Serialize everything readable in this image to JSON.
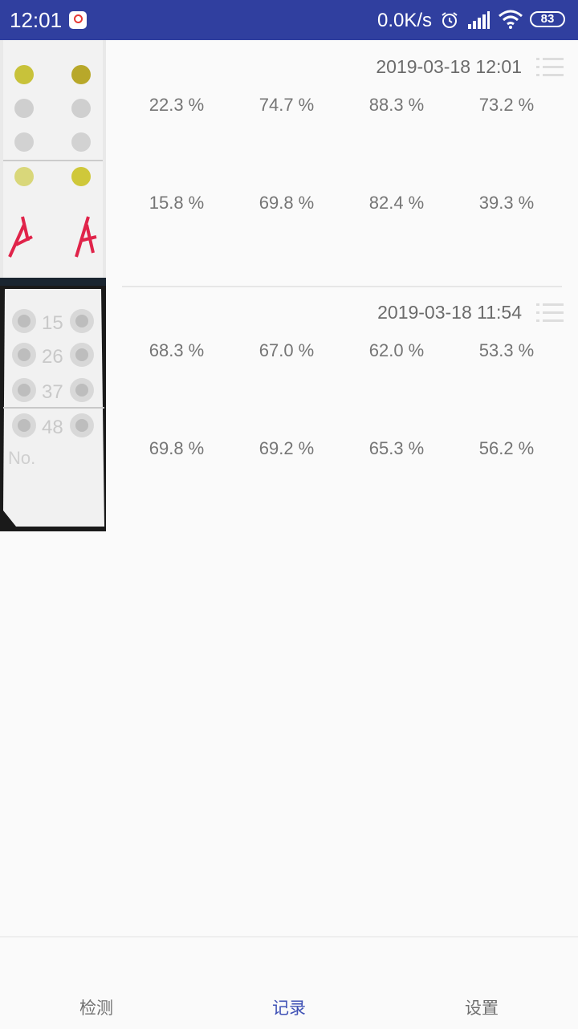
{
  "status_bar": {
    "time": "12:01",
    "network_speed": "0.0K/s",
    "battery": "83"
  },
  "records": [
    {
      "datetime": "2019-03-18 12:01",
      "row1": [
        "22.3 %",
        "74.7 %",
        "88.3 %",
        "73.2 %"
      ],
      "row2": [
        "15.8 %",
        "69.8 %",
        "82.4 %",
        "39.3 %"
      ],
      "thumb_handwriting": "11.18"
    },
    {
      "datetime": "2019-03-18 11:54",
      "row1": [
        "68.3 %",
        "67.0 %",
        "62.0 %",
        "53.3 %"
      ],
      "row2": [
        "69.8 %",
        "69.2 %",
        "65.3 %",
        "56.2 %"
      ],
      "thumb_numbers": [
        "15",
        "26",
        "37",
        "48"
      ],
      "thumb_no": "No."
    }
  ],
  "nav": {
    "items": [
      "检测",
      "记录",
      "设置"
    ],
    "active_index": 1
  },
  "colors": {
    "status_bar": "#303f9f",
    "accent": "#3f51b5",
    "value_text": "#757575"
  },
  "icons": [
    "alarm-icon",
    "signal-icon",
    "wifi-icon",
    "battery-icon",
    "list-menu-icon"
  ]
}
